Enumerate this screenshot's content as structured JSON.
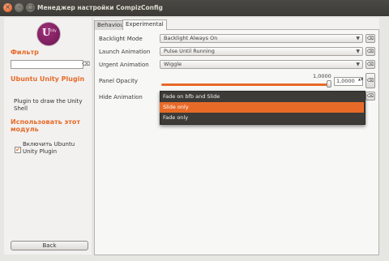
{
  "window": {
    "title": "Менеджер настройки CompizConfig",
    "close_glyph": "×",
    "min_glyph": "–",
    "max_glyph": "□"
  },
  "logo": {
    "letter": "U",
    "sup": "nity"
  },
  "sidebar": {
    "filter_label": "Фильтр",
    "filter_value": "",
    "filter_clear": "⌫",
    "plugin_title": "Ubuntu Unity Plugin",
    "plugin_description": "Plugin to draw the Unity Shell",
    "use_title": "Использовать этот модуль",
    "enable_label": "Включить Ubuntu Unity Plugin",
    "enable_checked": "✔",
    "back_label": "Back"
  },
  "tabs": [
    {
      "label": "Behaviour",
      "active": false
    },
    {
      "label": "Experimental",
      "active": true
    }
  ],
  "settings": {
    "backlight_mode": {
      "label": "Backlight Mode",
      "value": "Backlight Always On"
    },
    "launch_animation": {
      "label": "Launch Animation",
      "value": "Pulse Until Running"
    },
    "urgent_animation": {
      "label": "Urgent Animation",
      "value": "Wiggle"
    },
    "panel_opacity": {
      "label": "Panel Opacity",
      "value_label": "1,0000",
      "spin_value": "1,0000",
      "fraction": 1.0
    },
    "hide_animation": {
      "label": "Hide Animation",
      "value": "Slide only"
    }
  },
  "dropdown_options": [
    "Fade on bfb and Slide",
    "Slide only",
    "Fade only"
  ],
  "reset_glyph": "⌫",
  "combo_arrow": "▼",
  "spin_arrows": "▲▼",
  "colors": {
    "accent": "#e86a28",
    "titlebar": "#3c3b37",
    "menu_bg": "#3c3b37"
  }
}
